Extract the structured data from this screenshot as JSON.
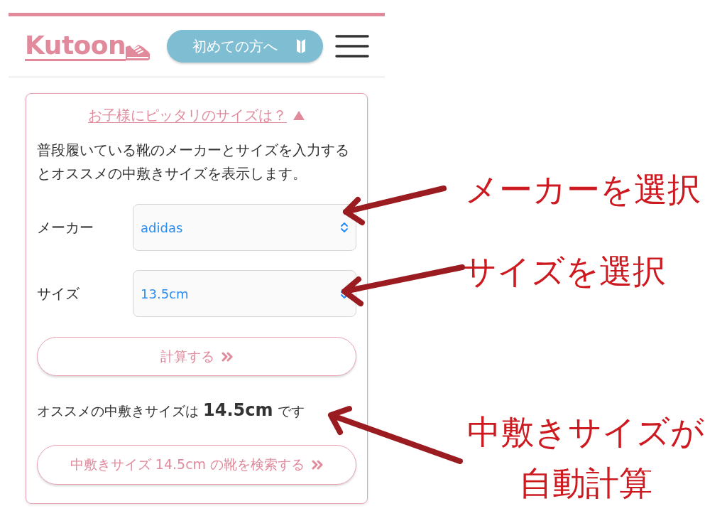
{
  "header": {
    "logo": "Kutoon",
    "guide_button": "初めての方へ"
  },
  "size_card": {
    "toggle": {
      "label": "お子様にピッタリのサイズは？",
      "expanded": true
    },
    "description": "普段履いている靴のメーカーとサイズを入力するとオススメの中敷きサイズを表示します。",
    "fields": [
      {
        "label": "メーカー",
        "value": "adidas"
      },
      {
        "label": "サイズ",
        "value": "13.5cm"
      }
    ],
    "calculate_button": "計算する",
    "result": "オススメの中敷きサイズは **14.5cm** です",
    "search_button": "中敷きサイズ 14.5cm の靴を検索する"
  },
  "annotations": [
    "メーカーを選択",
    "サイズを選択",
    "中敷きサイズが自動計算"
  ]
}
